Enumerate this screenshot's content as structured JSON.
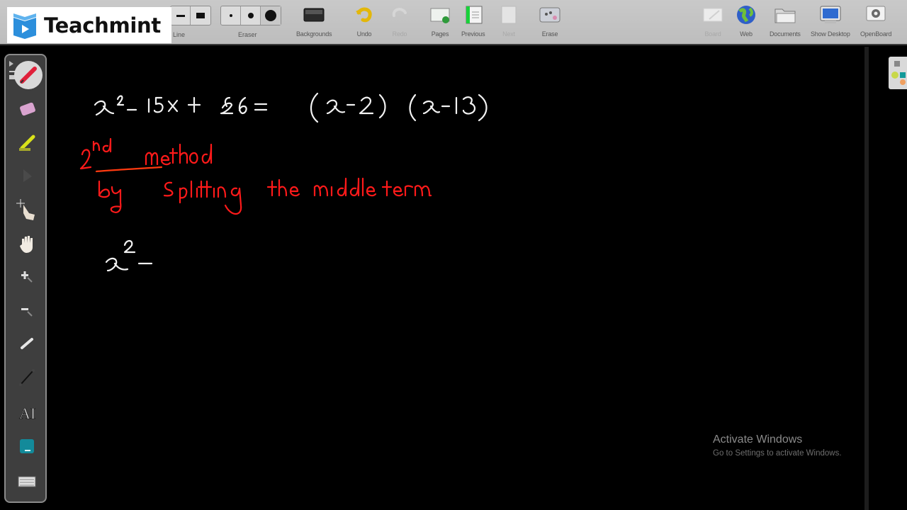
{
  "app": {
    "name": "OpenBoard",
    "logo_text": "Teachmint",
    "brand_color": "#2c8fdc"
  },
  "toolbar": {
    "line_label": "Line",
    "eraser_label": "Eraser",
    "buttons": [
      {
        "id": "backgrounds",
        "label": "Backgrounds",
        "icon": "backgrounds-icon",
        "enabled": true
      },
      {
        "id": "undo",
        "label": "Undo",
        "icon": "undo-icon",
        "enabled": true
      },
      {
        "id": "redo",
        "label": "Redo",
        "icon": "redo-icon",
        "enabled": false
      },
      {
        "id": "pages",
        "label": "Pages",
        "icon": "pages-icon",
        "enabled": true
      },
      {
        "id": "previous",
        "label": "Previous",
        "icon": "previous-icon",
        "enabled": true
      },
      {
        "id": "next",
        "label": "Next",
        "icon": "next-icon",
        "enabled": false
      },
      {
        "id": "erase",
        "label": "Erase",
        "icon": "erase-icon",
        "enabled": true
      },
      {
        "id": "board",
        "label": "Board",
        "icon": "board-icon",
        "enabled": false
      },
      {
        "id": "web",
        "label": "Web",
        "icon": "globe-icon",
        "enabled": true
      },
      {
        "id": "documents",
        "label": "Documents",
        "icon": "folder-icon",
        "enabled": true
      },
      {
        "id": "show-desktop",
        "label": "Show Desktop",
        "icon": "monitor-icon",
        "enabled": true
      },
      {
        "id": "openboard",
        "label": "OpenBoard",
        "icon": "gear-icon",
        "enabled": true
      }
    ]
  },
  "palette": {
    "tools": [
      {
        "id": "pen",
        "icon": "pen-icon",
        "active": true
      },
      {
        "id": "eraser",
        "icon": "eraser-icon",
        "active": false
      },
      {
        "id": "highlighter",
        "icon": "highlighter-icon",
        "active": false
      },
      {
        "id": "selector",
        "icon": "selector-icon",
        "active": false
      },
      {
        "id": "interact",
        "icon": "pointer-hand-icon",
        "active": false
      },
      {
        "id": "hand",
        "icon": "hand-icon",
        "active": false
      },
      {
        "id": "zoom-in",
        "icon": "zoom-in-icon",
        "active": false
      },
      {
        "id": "zoom-out",
        "icon": "zoom-out-icon",
        "active": false
      },
      {
        "id": "laser",
        "icon": "laser-pointer-icon",
        "active": false
      },
      {
        "id": "line",
        "icon": "line-icon",
        "active": false
      },
      {
        "id": "text",
        "icon": "text-icon",
        "active": false
      },
      {
        "id": "capture",
        "icon": "capture-icon",
        "active": false
      },
      {
        "id": "keyboard",
        "icon": "keyboard-icon",
        "active": false
      }
    ]
  },
  "board": {
    "handwriting": {
      "line1": "x² - 15x + 26 = (x-2) (x-13)",
      "line2": "2nd method",
      "line3": "by splitting the middle term",
      "line4": "x² -"
    },
    "colors": {
      "ink_white": "#f2f2f2",
      "ink_red": "#ff1a1a"
    }
  },
  "watermark": {
    "title": "Activate Windows",
    "subtitle": "Go to Settings to activate Windows."
  }
}
